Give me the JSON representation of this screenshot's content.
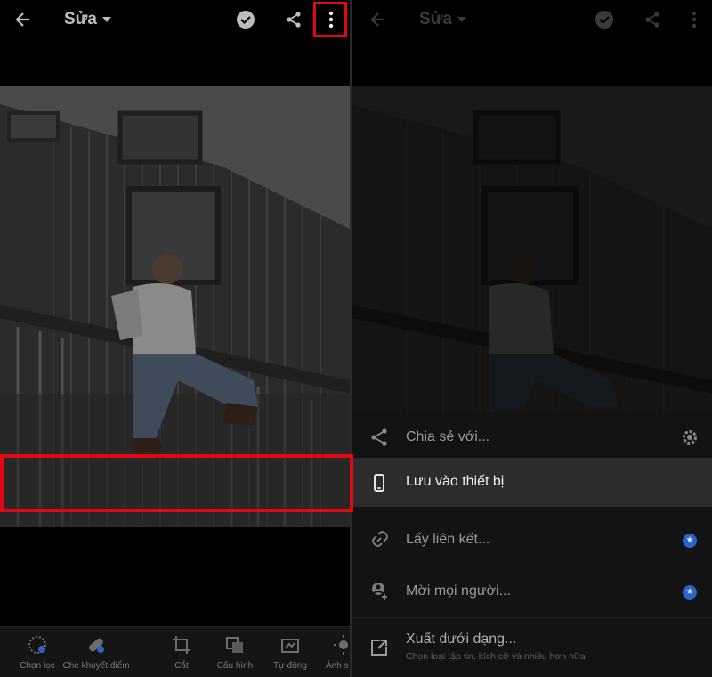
{
  "accent": "#e30613",
  "top_bar": {
    "title": "Sửa",
    "icons": [
      "arrow-left-icon",
      "chevron-down-icon",
      "check-circle-icon",
      "share-icon",
      "more-vertical-icon"
    ]
  },
  "bottom_toolbar": {
    "items": [
      {
        "label": "Chọn lọc",
        "icon": "selective-brush-icon"
      },
      {
        "label": "Che khuyết điểm",
        "icon": "healing-bandage-icon"
      },
      {
        "label": "Cắt",
        "icon": "crop-icon"
      },
      {
        "label": "Cấu hình",
        "icon": "profiles-icon"
      },
      {
        "label": "Tự động",
        "icon": "auto-icon"
      },
      {
        "label": "Ánh s",
        "icon": "light-icon"
      }
    ]
  },
  "share_sheet": {
    "items": [
      {
        "label": "Chia sẻ với...",
        "icon": "share-icon",
        "trailing": "gear-icon"
      },
      {
        "label": "Lưu vào thiết bị",
        "icon": "phone-icon"
      },
      {
        "label": "Lấy liên kết...",
        "icon": "link-icon",
        "trailing": "premium-star-icon"
      },
      {
        "label": "Mời mọi người...",
        "icon": "add-person-icon",
        "trailing": "premium-star-icon"
      },
      {
        "label": "Xuất dưới dạng...",
        "sublabel": "Chọn loại tập tin, kích cỡ và nhiều hơn nữa",
        "icon": "export-icon"
      }
    ]
  }
}
